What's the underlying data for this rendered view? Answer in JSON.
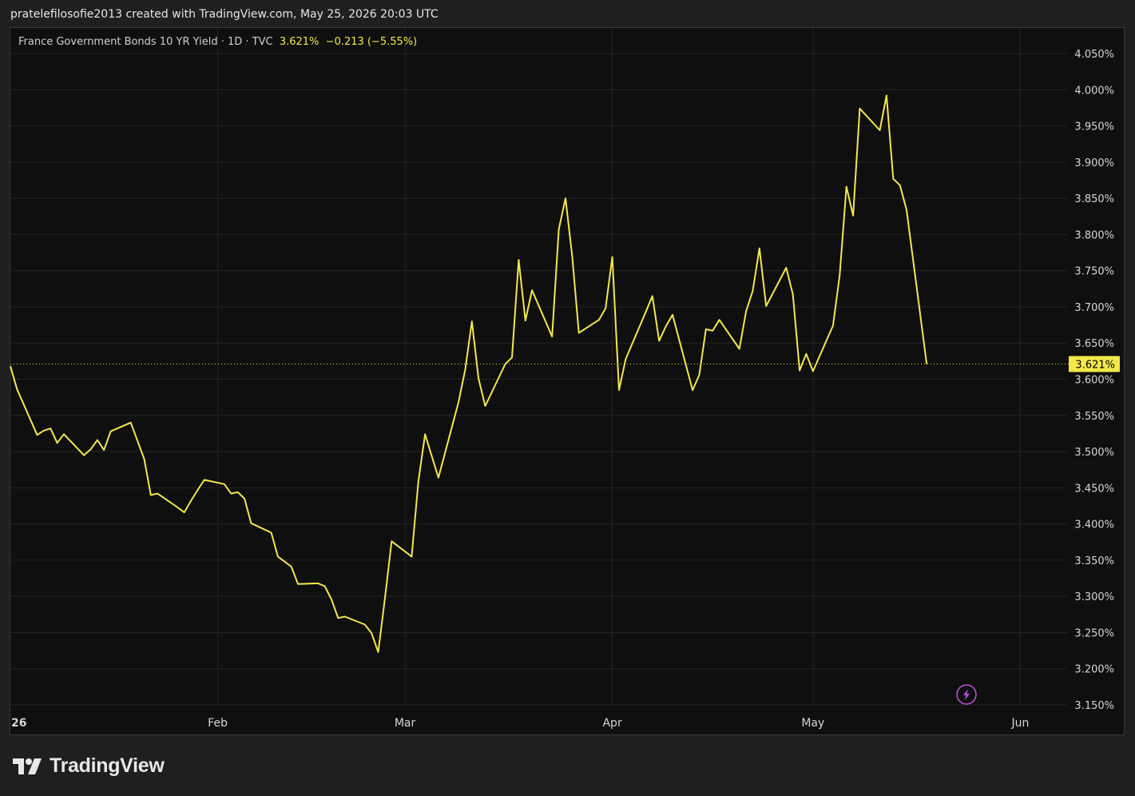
{
  "header": {
    "attribution": "pratelefilosofie2013 created with TradingView.com, May 25, 2026 20:03 UTC"
  },
  "legend": {
    "symbol": "France Government Bonds 10 YR Yield · 1D · TVC",
    "last": "3.621%",
    "change": "−0.213 (−5.55%)"
  },
  "footer": {
    "brand": "TradingView"
  },
  "colors": {
    "line": "#f3e84a",
    "background": "#0f0f0f",
    "grid": "#242424",
    "axis_text": "#d6d6d6"
  },
  "chart_data": {
    "type": "line",
    "title": "France Government Bonds 10 YR Yield · 1D · TVC",
    "xlabel": "",
    "ylabel": "",
    "ylim": [
      3.15,
      4.05
    ],
    "y_unit": "%",
    "y_ticks": [
      "4.050%",
      "4.000%",
      "3.950%",
      "3.900%",
      "3.850%",
      "3.800%",
      "3.750%",
      "3.700%",
      "3.650%",
      "3.600%",
      "3.550%",
      "3.500%",
      "3.450%",
      "3.400%",
      "3.350%",
      "3.300%",
      "3.250%",
      "3.200%",
      "3.150%"
    ],
    "x_ticks": [
      {
        "label": "26",
        "date": "2026-01-01"
      },
      {
        "label": "Feb",
        "date": "2026-02-01"
      },
      {
        "label": "Mar",
        "date": "2026-03-01"
      },
      {
        "label": "Apr",
        "date": "2026-04-01"
      },
      {
        "label": "May",
        "date": "2026-05-01"
      },
      {
        "label": "Jun",
        "date": "2026-06-01"
      }
    ],
    "x_range": [
      "2026-01-01",
      "2026-06-08"
    ],
    "last_value": 3.621,
    "grid": true,
    "series": [
      {
        "values": [
          [
            "2026-01-01",
            3.618
          ],
          [
            "2026-01-02",
            3.586
          ],
          [
            "2026-01-05",
            3.523
          ],
          [
            "2026-01-06",
            3.529
          ],
          [
            "2026-01-07",
            3.532
          ],
          [
            "2026-01-08",
            3.512
          ],
          [
            "2026-01-09",
            3.524
          ],
          [
            "2026-01-12",
            3.495
          ],
          [
            "2026-01-13",
            3.503
          ],
          [
            "2026-01-14",
            3.516
          ],
          [
            "2026-01-15",
            3.502
          ],
          [
            "2026-01-16",
            3.528
          ],
          [
            "2026-01-19",
            3.54
          ],
          [
            "2026-01-20",
            3.515
          ],
          [
            "2026-01-21",
            3.49
          ],
          [
            "2026-01-22",
            3.44
          ],
          [
            "2026-01-23",
            3.442
          ],
          [
            "2026-01-26",
            3.423
          ],
          [
            "2026-01-27",
            3.416
          ],
          [
            "2026-01-28",
            3.432
          ],
          [
            "2026-01-29",
            3.447
          ],
          [
            "2026-01-30",
            3.461
          ],
          [
            "2026-02-02",
            3.455
          ],
          [
            "2026-02-03",
            3.442
          ],
          [
            "2026-02-04",
            3.444
          ],
          [
            "2026-02-05",
            3.435
          ],
          [
            "2026-02-06",
            3.401
          ],
          [
            "2026-02-09",
            3.388
          ],
          [
            "2026-02-10",
            3.355
          ],
          [
            "2026-02-11",
            3.348
          ],
          [
            "2026-02-12",
            3.341
          ],
          [
            "2026-02-13",
            3.317
          ],
          [
            "2026-02-16",
            3.318
          ],
          [
            "2026-02-17",
            3.314
          ],
          [
            "2026-02-18",
            3.296
          ],
          [
            "2026-02-19",
            3.27
          ],
          [
            "2026-02-20",
            3.272
          ],
          [
            "2026-02-23",
            3.261
          ],
          [
            "2026-02-24",
            3.249
          ],
          [
            "2026-02-25",
            3.223
          ],
          [
            "2026-02-26",
            3.297
          ],
          [
            "2026-02-27",
            3.376
          ],
          [
            "2026-03-02",
            3.355
          ],
          [
            "2026-03-03",
            3.459
          ],
          [
            "2026-03-04",
            3.524
          ],
          [
            "2026-03-05",
            3.494
          ],
          [
            "2026-03-06",
            3.464
          ],
          [
            "2026-03-09",
            3.568
          ],
          [
            "2026-03-10",
            3.613
          ],
          [
            "2026-03-11",
            3.68
          ],
          [
            "2026-03-12",
            3.601
          ],
          [
            "2026-03-13",
            3.563
          ],
          [
            "2026-03-16",
            3.621
          ],
          [
            "2026-03-17",
            3.63
          ],
          [
            "2026-03-18",
            3.765
          ],
          [
            "2026-03-19",
            3.681
          ],
          [
            "2026-03-20",
            3.723
          ],
          [
            "2026-03-23",
            3.659
          ],
          [
            "2026-03-24",
            3.807
          ],
          [
            "2026-03-25",
            3.85
          ],
          [
            "2026-03-26",
            3.77
          ],
          [
            "2026-03-27",
            3.664
          ],
          [
            "2026-03-30",
            3.682
          ],
          [
            "2026-03-31",
            3.698
          ],
          [
            "2026-04-01",
            3.769
          ],
          [
            "2026-04-02",
            3.585
          ],
          [
            "2026-04-03",
            3.628
          ],
          [
            "2026-04-06",
            3.693
          ],
          [
            "2026-04-07",
            3.715
          ],
          [
            "2026-04-08",
            3.653
          ],
          [
            "2026-04-09",
            3.673
          ],
          [
            "2026-04-10",
            3.689
          ],
          [
            "2026-04-13",
            3.585
          ],
          [
            "2026-04-14",
            3.606
          ],
          [
            "2026-04-15",
            3.669
          ],
          [
            "2026-04-16",
            3.667
          ],
          [
            "2026-04-17",
            3.682
          ],
          [
            "2026-04-20",
            3.642
          ],
          [
            "2026-04-21",
            3.694
          ],
          [
            "2026-04-22",
            3.722
          ],
          [
            "2026-04-23",
            3.781
          ],
          [
            "2026-04-24",
            3.701
          ],
          [
            "2026-04-27",
            3.754
          ],
          [
            "2026-04-28",
            3.717
          ],
          [
            "2026-04-29",
            3.612
          ],
          [
            "2026-04-30",
            3.635
          ],
          [
            "2026-05-01",
            3.611
          ],
          [
            "2026-05-04",
            3.674
          ],
          [
            "2026-05-05",
            3.744
          ],
          [
            "2026-05-06",
            3.866
          ],
          [
            "2026-05-07",
            3.826
          ],
          [
            "2026-05-08",
            3.974
          ],
          [
            "2026-05-11",
            3.944
          ],
          [
            "2026-05-12",
            3.992
          ],
          [
            "2026-05-13",
            3.877
          ],
          [
            "2026-05-14",
            3.868
          ],
          [
            "2026-05-15",
            3.834
          ],
          [
            "2026-05-18",
            3.621
          ]
        ]
      }
    ]
  }
}
